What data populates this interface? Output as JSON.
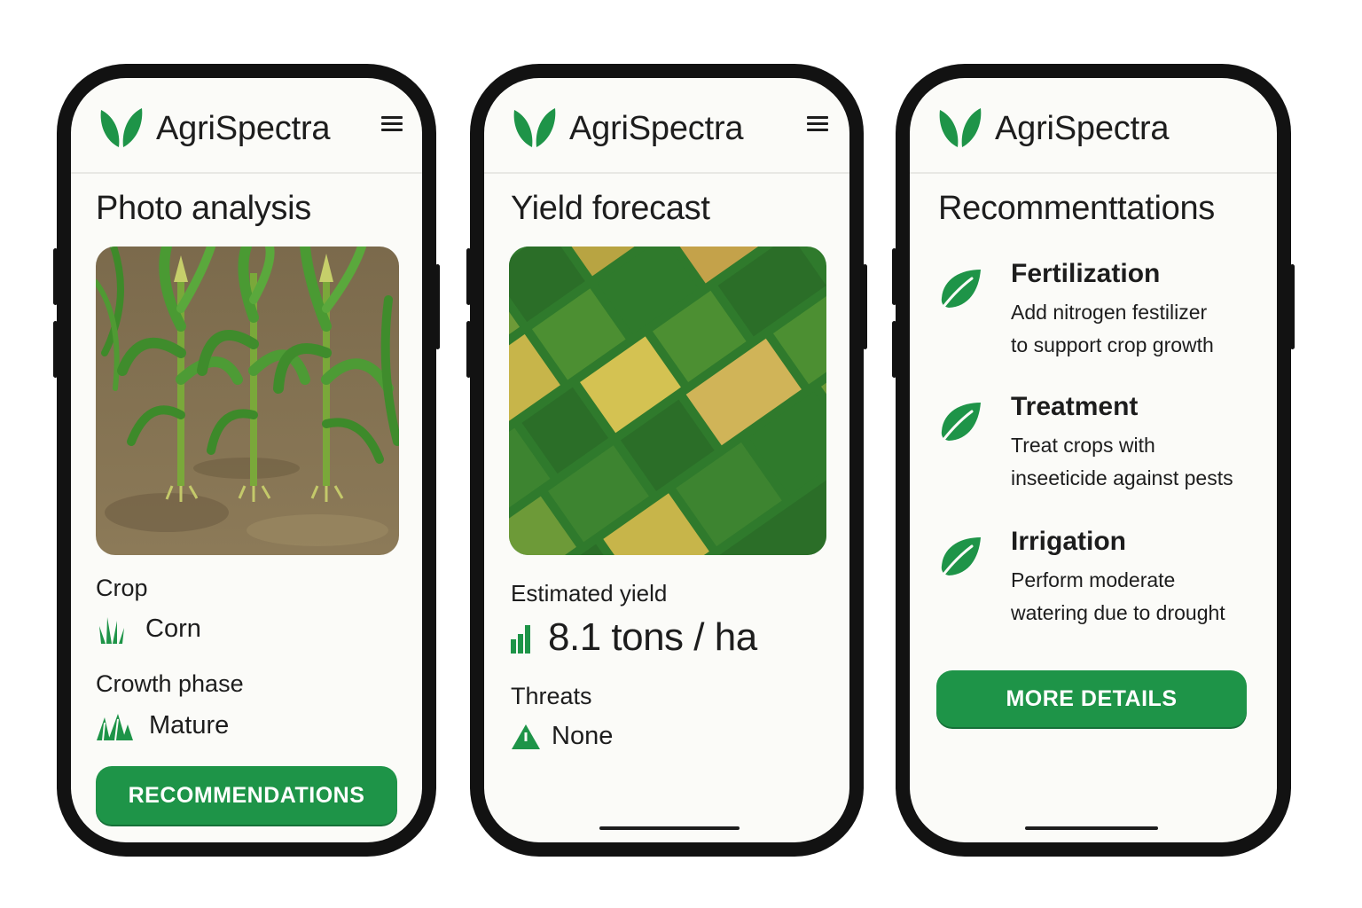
{
  "brand": {
    "name": "AgriSpectra",
    "color": "#1e9448"
  },
  "screens": [
    {
      "title": "Photo analysis",
      "photo_alt": "corn-field-photo",
      "crop_label": "Crop",
      "crop_value": "Corn",
      "phase_label": "Crowth phase",
      "phase_value": "Mature",
      "button_label": "RECOMMENDATIONS"
    },
    {
      "title": "Yield forecast",
      "photo_alt": "aerial-fields-photo",
      "yield_label": "Estimated yield",
      "yield_value": "8.1 tons / ha",
      "threats_label": "Threats",
      "threats_value": "None"
    },
    {
      "title": "Recommenttations",
      "items": [
        {
          "title": "Fertilization",
          "line1": "Add nitrogen festilizer",
          "line2": "to support crop growth",
          "icon": "leaf-icon"
        },
        {
          "title": "Treatment",
          "line1": "Treat crops with",
          "line2": "inseeticide against pests",
          "icon": "leaf-icon"
        },
        {
          "title": "Irrigation",
          "line1": "Perform moderate",
          "line2": "watering due to drought",
          "icon": "leaf-icon"
        }
      ],
      "button_label": "MORE DETAILS"
    }
  ]
}
